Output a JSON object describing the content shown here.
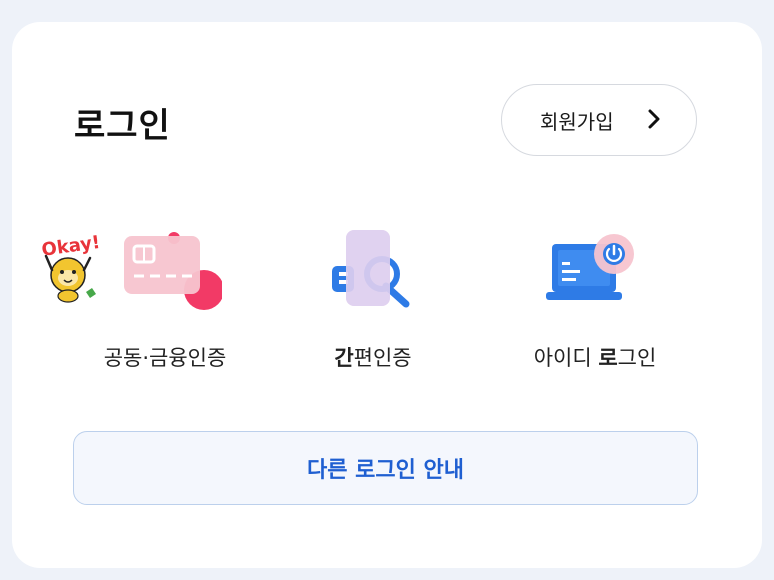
{
  "header": {
    "title": "로그인",
    "signup_label": "회원가입"
  },
  "login_options": [
    {
      "label": "공동·금융인증",
      "icon": "certificate-card-icon",
      "sticker": "Okay!"
    },
    {
      "label_prefix": "간",
      "label_rest": "편인증",
      "icon": "simple-auth-phone-icon"
    },
    {
      "label_prefix": "아이디 ",
      "label_bold": "로",
      "label_rest": "그인",
      "icon": "laptop-power-icon"
    }
  ],
  "other_login_label": "다른 로그인 안내",
  "colors": {
    "accent": "#1f5fd1",
    "card_pink": "#f7b4c4",
    "card_red": "#f23a66",
    "laptop_blue": "#2e7be6"
  }
}
